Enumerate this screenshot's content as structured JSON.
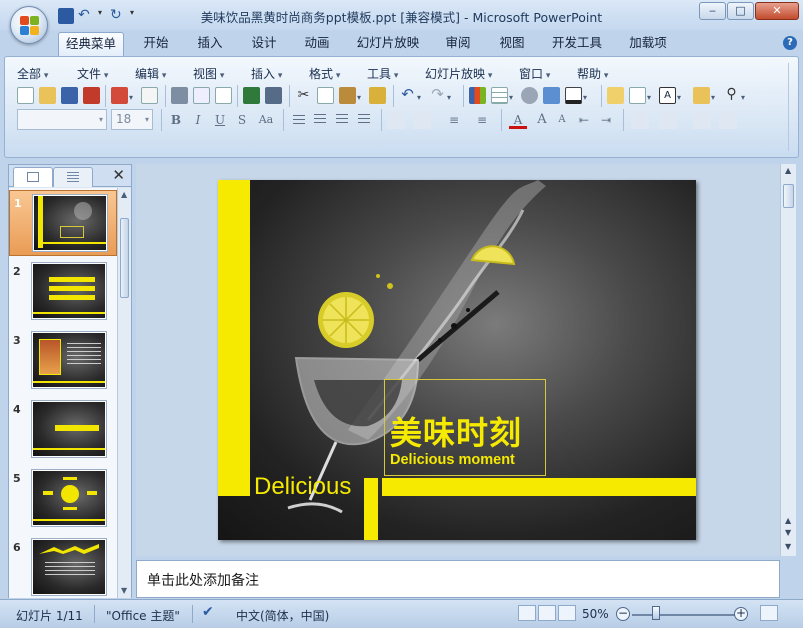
{
  "window": {
    "title": "美味饮品黑黄时尚商务ppt模板.ppt [兼容模式] - Microsoft PowerPoint"
  },
  "ribbon_tabs": [
    "经典菜单",
    "开始",
    "插入",
    "设计",
    "动画",
    "幻灯片放映",
    "审阅",
    "视图",
    "开发工具",
    "加载项"
  ],
  "active_tab": "经典菜单",
  "menu": [
    "全部",
    "文件",
    "编辑",
    "视图",
    "插入",
    "格式",
    "工具",
    "幻灯片放映",
    "窗口",
    "帮助"
  ],
  "font": {
    "name": "",
    "size": "18"
  },
  "slides_pane": {
    "slide_numbers": [
      "1",
      "2",
      "3",
      "4",
      "5",
      "6"
    ],
    "selected": "1"
  },
  "slide": {
    "title_cn": "美味时刻",
    "subtitle_en": "Delicious moment",
    "word": "Delicious"
  },
  "notes": {
    "placeholder": "单击此处添加备注"
  },
  "status": {
    "slide_counter": "幻灯片 1/11",
    "theme": "\"Office 主题\"",
    "language": "中文(简体，中国)",
    "zoom": "50%"
  },
  "colors": {
    "accent_yellow": "#f5ea00",
    "selected_thumb": "#e99c55",
    "ribbon_blue": "#d7e5f4"
  }
}
